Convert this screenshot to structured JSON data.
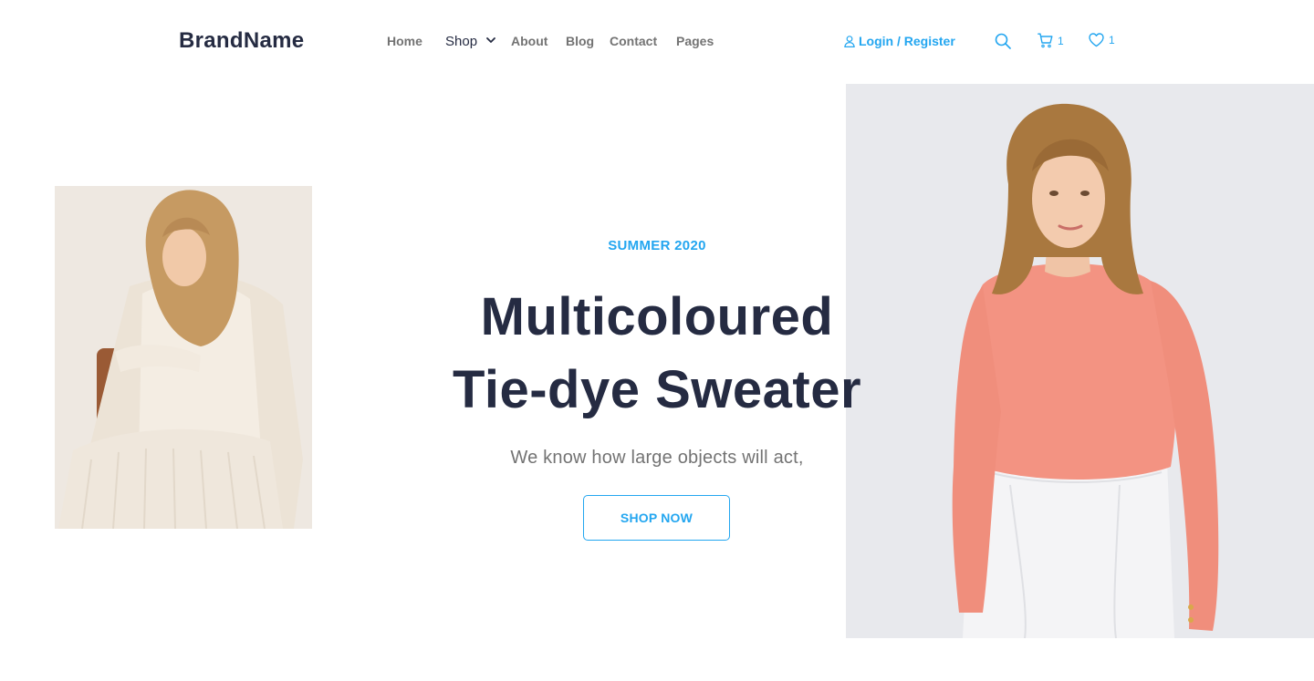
{
  "header": {
    "brand": "BrandName",
    "nav": {
      "home": "Home",
      "shop": "Shop",
      "about": "About",
      "blog": "Blog",
      "contact": "Contact",
      "pages": "Pages"
    },
    "login_label": "Login / Register",
    "cart_count": "1",
    "wishlist_count": "1",
    "icons": [
      "user-icon",
      "search-icon",
      "cart-icon",
      "heart-icon",
      "chevron-down-icon"
    ]
  },
  "hero": {
    "eyebrow": "SUMMER 2020",
    "title_line1": "Multicoloured",
    "title_line2": "Tie-dye Sweater",
    "subtitle": "We know how large objects will act,",
    "cta_label": "SHOP NOW"
  },
  "colors": {
    "accent": "#23A6F0",
    "heading": "#252B42",
    "muted": "#737373"
  }
}
